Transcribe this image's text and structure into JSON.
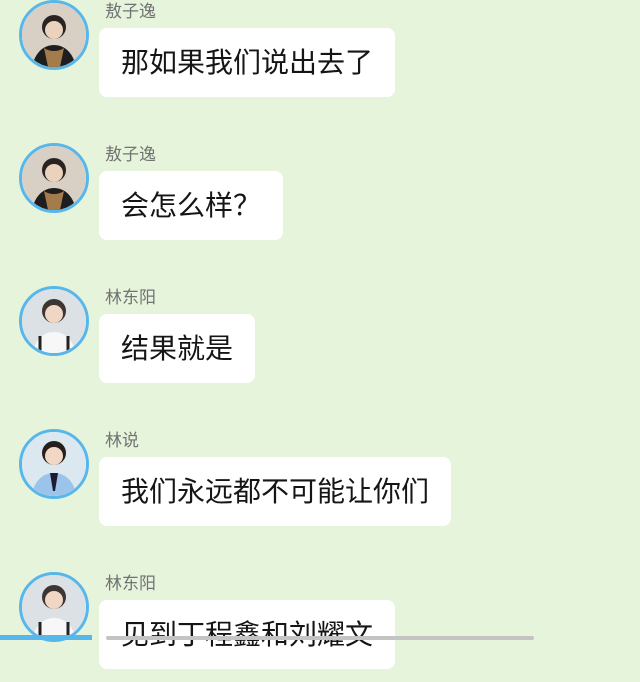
{
  "messages": [
    {
      "sender": "敖子逸",
      "text": "那如果我们说出去了",
      "avatar_icon": "person-photo-avatar-icon"
    },
    {
      "sender": "敖子逸",
      "text": "会怎么样？",
      "avatar_icon": "person-photo-avatar-icon"
    },
    {
      "sender": "林东阳",
      "text": "结果就是",
      "avatar_icon": "person-photo-avatar-icon"
    },
    {
      "sender": "林说",
      "text": "我们永远都不可能让你们",
      "avatar_icon": "person-photo-avatar-icon"
    },
    {
      "sender": "林东阳",
      "text": "见到丁程鑫和刘耀文",
      "avatar_icon": "person-photo-avatar-icon"
    }
  ],
  "colors": {
    "background": "#e6f4dc",
    "bubble": "#ffffff",
    "avatar_ring": "#58b7ea",
    "sender_name": "#727272",
    "message_text": "#151515"
  }
}
